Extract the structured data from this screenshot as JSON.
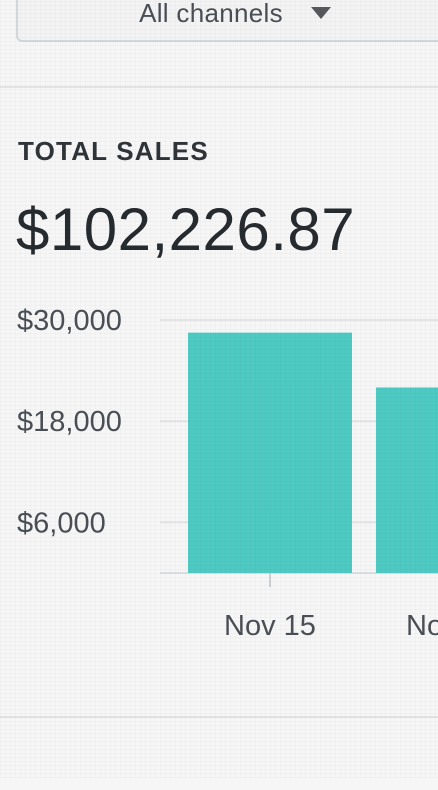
{
  "channel_filter": {
    "selected": "All channels",
    "icon": "caret-down-icon"
  },
  "sales_card": {
    "title": "TOTAL SALES",
    "total": "$102,226.87"
  },
  "chart_data": {
    "type": "bar",
    "categories": [
      "Nov 15",
      "No"
    ],
    "values": [
      28500,
      22000
    ],
    "y_ticks": [
      "$30,000",
      "$18,000",
      "$6,000"
    ],
    "y_tick_values": [
      30000,
      18000,
      6000
    ],
    "ylim": [
      0,
      30000
    ],
    "grid": true,
    "bar_color": "#4fcac3",
    "tick_color": "#4a4f55",
    "grid_color": "#e2e4e6"
  }
}
